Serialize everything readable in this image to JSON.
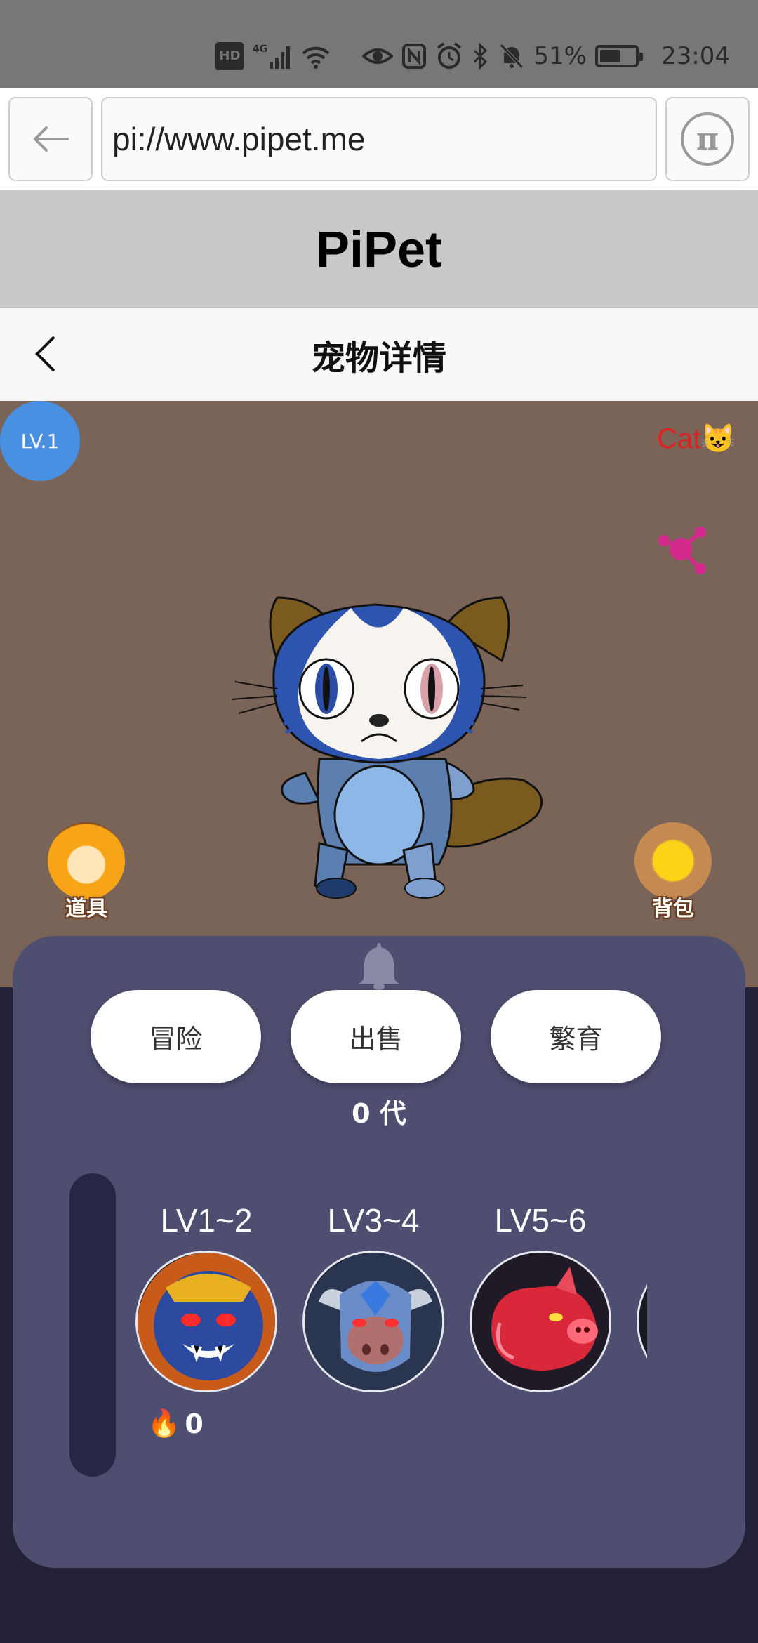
{
  "status_bar": {
    "hd": "HD",
    "network": "4G",
    "battery_percent": "51%",
    "time": "23:04"
  },
  "browser": {
    "url": "pi://www.pipet.me",
    "pi_symbol": "π"
  },
  "app": {
    "title": "PiPet"
  },
  "header": {
    "title": "宠物详情"
  },
  "pet": {
    "level": "LV.1",
    "type": "Cat😺"
  },
  "side_buttons": {
    "props": "道具",
    "bag": "背包"
  },
  "actions": {
    "adventure": "冒险",
    "sell": "出售",
    "breed": "繁育"
  },
  "generation": "0 代",
  "levels": [
    {
      "label": "LV1~2"
    },
    {
      "label": "LV3~4"
    },
    {
      "label": "LV5~6"
    }
  ],
  "fire": {
    "icon": "🔥",
    "count": "0"
  }
}
